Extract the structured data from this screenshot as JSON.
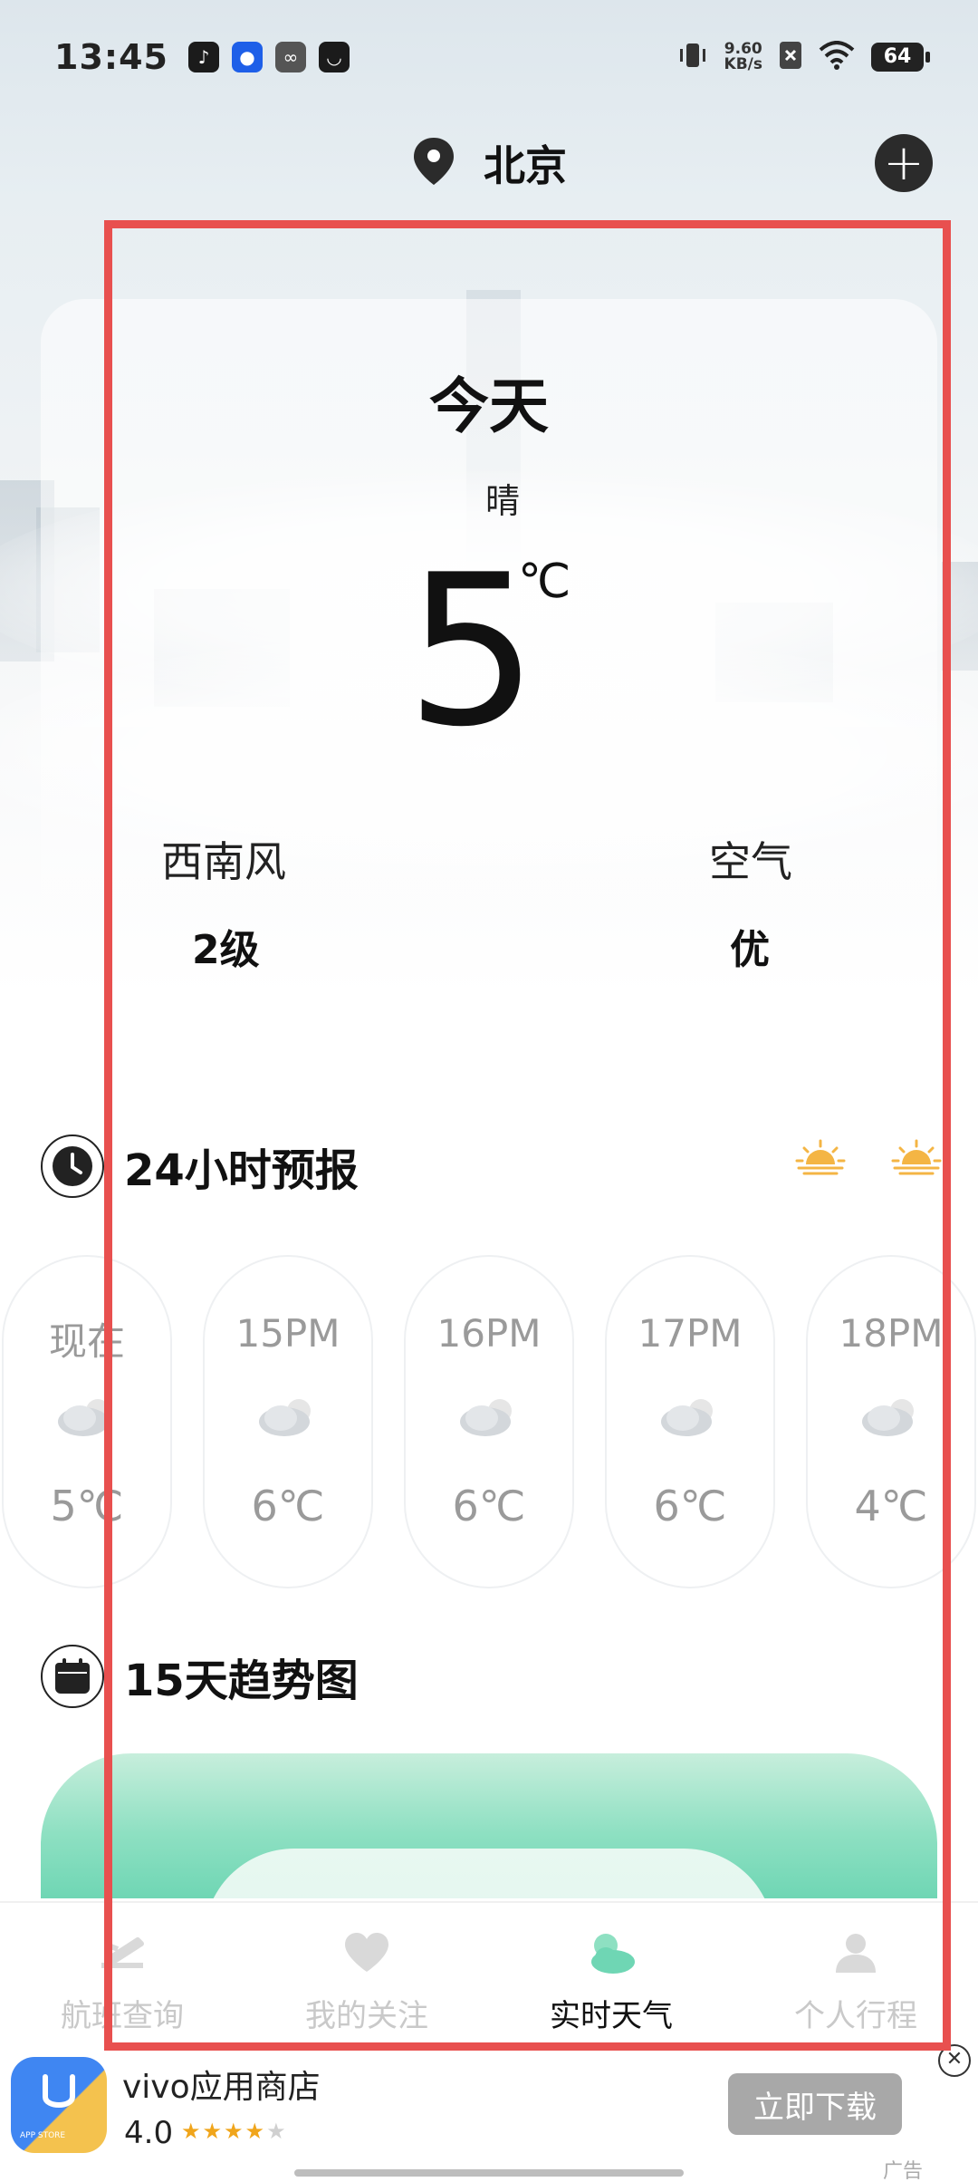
{
  "status_bar": {
    "time": "13:45",
    "net_speed_value": "9.60",
    "net_speed_unit": "KB/s",
    "battery": "64"
  },
  "header": {
    "city": "北京",
    "add_label": "+"
  },
  "today": {
    "title": "今天",
    "condition": "晴",
    "temperature": "5",
    "unit": "℃",
    "wind_label": "西南风",
    "wind_value": "2级",
    "air_label": "空气",
    "air_value": "优"
  },
  "hourly": {
    "title": "24小时预报",
    "items": [
      {
        "time": "现在",
        "temp": "5℃",
        "icon": "cloudy-icon"
      },
      {
        "time": "15PM",
        "temp": "6℃",
        "icon": "cloudy-icon"
      },
      {
        "time": "16PM",
        "temp": "6℃",
        "icon": "cloudy-icon"
      },
      {
        "time": "17PM",
        "temp": "6℃",
        "icon": "cloudy-icon"
      },
      {
        "time": "18PM",
        "temp": "4℃",
        "icon": "cloudy-icon"
      }
    ]
  },
  "trend": {
    "title": "15天趋势图"
  },
  "nav": {
    "items": [
      {
        "label": "航班查询",
        "icon": "plane-icon"
      },
      {
        "label": "我的关注",
        "icon": "heart-icon"
      },
      {
        "label": "实时天气",
        "icon": "weather-icon"
      },
      {
        "label": "个人行程",
        "icon": "person-icon"
      }
    ],
    "active_index": 2
  },
  "ad": {
    "app_name": "vivo应用商店",
    "rating": "4.0",
    "download_label": "立即下载",
    "tag": "广告",
    "logo_text": "APP STORE"
  },
  "colors": {
    "accent_green": "#6fd6b4",
    "sun_orange": "#f4b544",
    "frame_red": "#e8504f"
  }
}
